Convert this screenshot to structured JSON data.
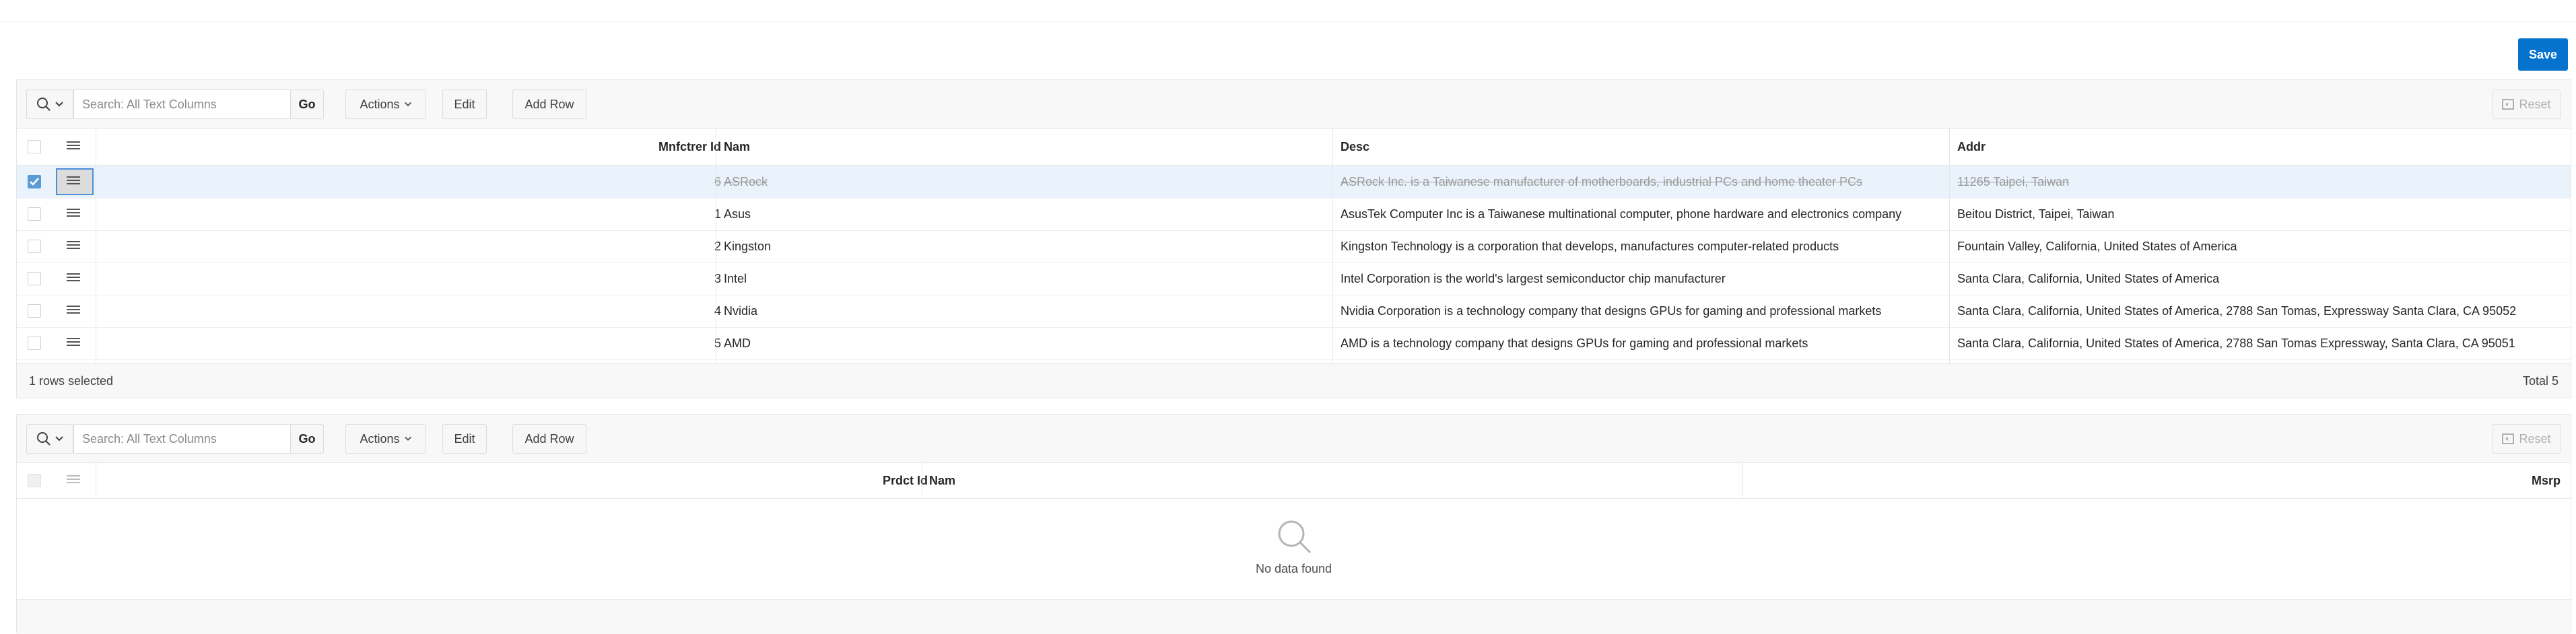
{
  "page": {
    "save_label": "Save"
  },
  "toolbar": {
    "search_placeholder": "Search: All Text Columns",
    "go_label": "Go",
    "actions_label": "Actions",
    "edit_label": "Edit",
    "add_row_label": "Add Row",
    "reset_label": "Reset"
  },
  "grid1": {
    "columns": [
      "Mnfctrer Id",
      "Nam",
      "Desc",
      "Addr"
    ],
    "rows": [
      {
        "id": "6",
        "nam": "ASRock",
        "desc": "ASRock Inc. is a Taiwanese manufacturer of motherboards, industrial PCs and home theater PCs",
        "addr": "11265 Taipei, Taiwan",
        "selected": true,
        "deleted": true
      },
      {
        "id": "1",
        "nam": "Asus",
        "desc": "AsusTek Computer Inc is a Taiwanese multinational computer, phone hardware and electronics company",
        "addr": "Beitou District, Taipei, Taiwan"
      },
      {
        "id": "2",
        "nam": "Kingston",
        "desc": "Kingston Technology is a corporation that develops, manufactures computer-related products",
        "addr": "Fountain Valley, California, United States of America"
      },
      {
        "id": "3",
        "nam": "Intel",
        "desc": "Intel Corporation is the world's largest semiconductor chip manufacturer",
        "addr": "Santa Clara, California, United States of America"
      },
      {
        "id": "4",
        "nam": "Nvidia",
        "desc": "Nvidia Corporation is a technology company that designs GPUs for gaming and professional markets",
        "addr": "Santa Clara, California, United States of America, 2788 San Tomas, Expressway Santa Clara, CA 95052"
      },
      {
        "id": "5",
        "nam": "AMD",
        "desc": "AMD is a technology company that designs GPUs for gaming and professional markets",
        "addr": "Santa Clara, California, United States of America, 2788 San Tomas Expressway, Santa Clara, CA 95051"
      }
    ],
    "footer_selected": "1 rows selected",
    "footer_total": "Total 5"
  },
  "grid2": {
    "columns": [
      "Prdct Id",
      "Nam",
      "Msrp"
    ],
    "no_data": "No data found"
  },
  "colors": {
    "accent": "#0572ce",
    "selected_row": "#eaf3fb",
    "checkbox_checked": "#5b9bd5"
  }
}
